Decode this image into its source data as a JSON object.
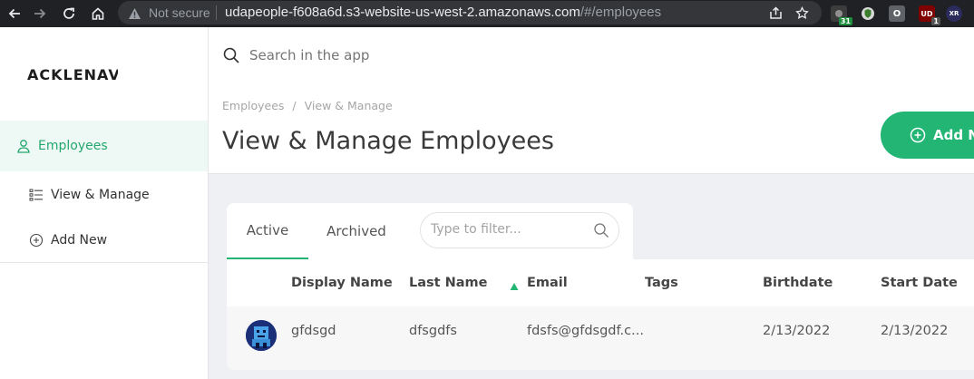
{
  "browser": {
    "security_label": "Not secure",
    "url_host": "udapeople-f608a6d.s3-website-us-west-2.amazonaws.com",
    "url_path": "/#/employees",
    "extensions": [
      {
        "icon": "puzzle-ext",
        "badge": "31",
        "color": "#3c3c3c"
      },
      {
        "icon": "shield-ext",
        "color": "#3c3c3c"
      },
      {
        "icon": "o-ext",
        "text": "O",
        "color": "#5f6368"
      },
      {
        "icon": "ublock-ext",
        "text": "UD",
        "badge": "1",
        "color": "#800000"
      },
      {
        "icon": "xr-ext",
        "text": "XR",
        "color": "#2b2b5c"
      }
    ]
  },
  "sidebar": {
    "logo": "ACKLENAVENUE",
    "items": [
      {
        "label": "Employees",
        "icon": "user-icon",
        "active": true
      },
      {
        "label": "View & Manage",
        "icon": "list-icon"
      },
      {
        "label": "Add New",
        "icon": "plus-circle-icon"
      }
    ]
  },
  "search": {
    "placeholder": "Search in the app"
  },
  "breadcrumb": [
    "Employees",
    "View & Manage"
  ],
  "page_title": "View & Manage Employees",
  "add_button": {
    "label": "Add New"
  },
  "tabs": [
    {
      "label": "Active",
      "active": true
    },
    {
      "label": "Archived"
    }
  ],
  "filter": {
    "placeholder": "Type to filter..."
  },
  "table": {
    "columns": [
      "Display Name",
      "Last Name",
      "Email",
      "Tags",
      "Birthdate",
      "Start Date"
    ],
    "sorted_column": "Email",
    "rows": [
      {
        "display_name": "gfdsgd",
        "last_name": "dfsgdfs",
        "email": "fdsfs@gfdsgdf.c...",
        "tags": "",
        "birthdate": "2/13/2022",
        "start_date": "2/13/2022"
      }
    ]
  },
  "colors": {
    "accent": "#22b573",
    "active_bg": "#eef9f5",
    "content_bg": "#eef0f3"
  }
}
